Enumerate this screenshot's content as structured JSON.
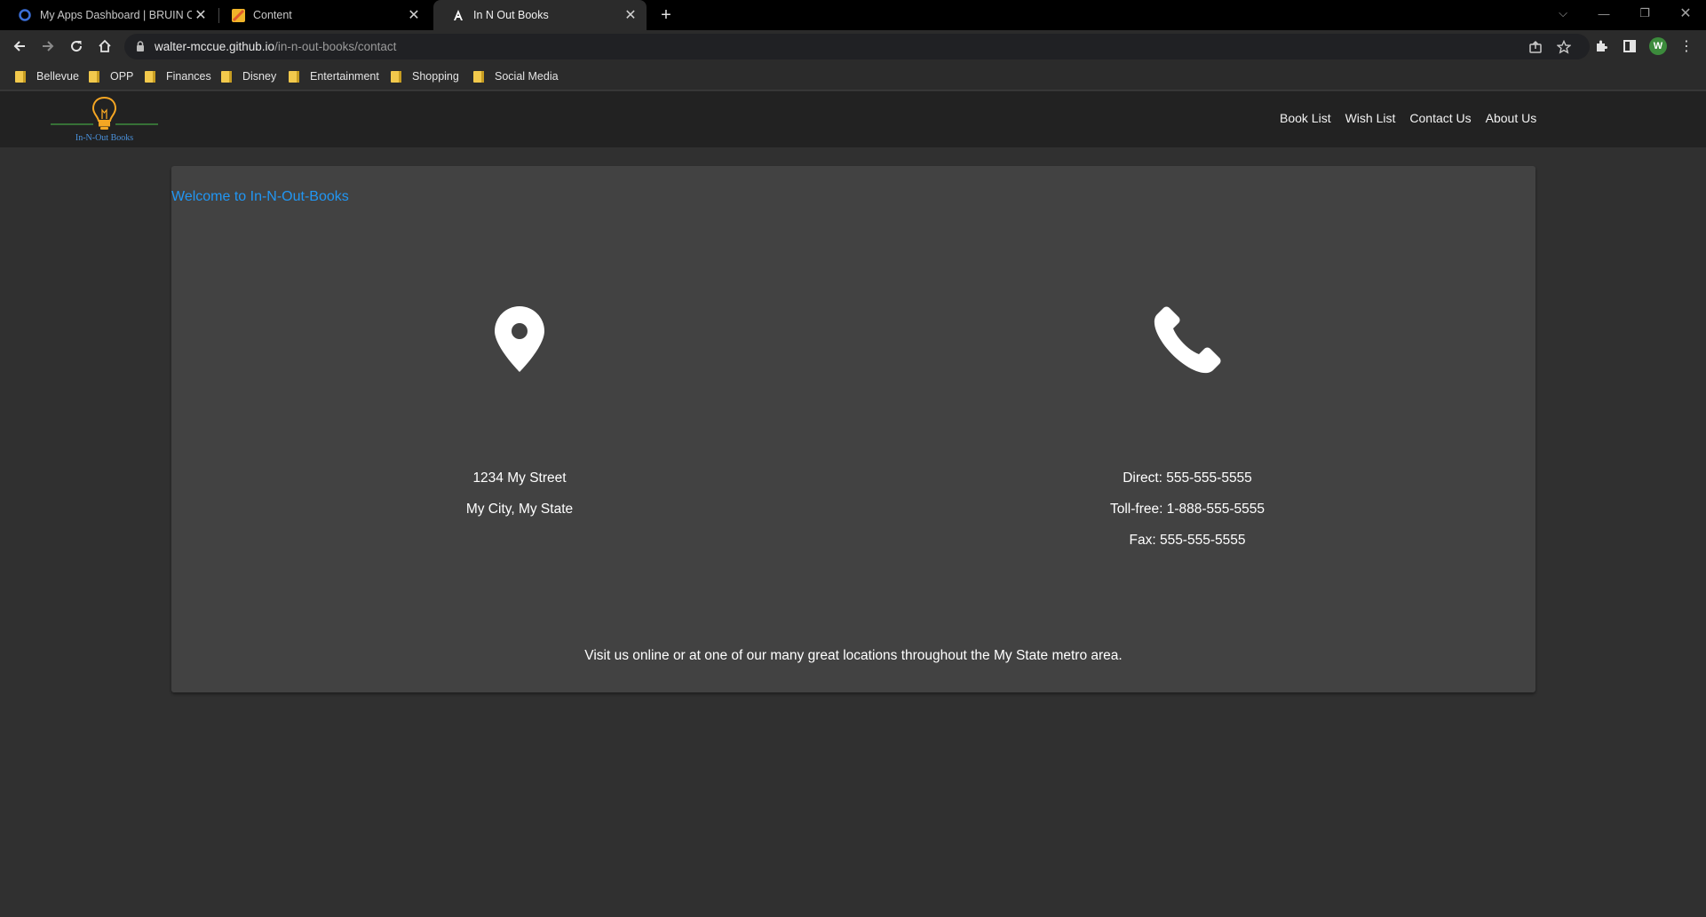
{
  "browser": {
    "tabs": [
      {
        "title": "My Apps Dashboard | BRUIN Co",
        "icon": "okta-icon",
        "active": false
      },
      {
        "title": "Content",
        "icon": "content-icon",
        "active": false
      },
      {
        "title": "In N Out Books",
        "icon": "angular-icon",
        "active": true
      }
    ],
    "new_tab_label": "+",
    "url": {
      "host": "walter-mccue.github.io",
      "path": "/in-n-out-books/contact"
    },
    "profile_initial": "W",
    "bookmarks": [
      "Bellevue",
      "OPP",
      "Finances",
      "Disney",
      "Entertainment",
      "Shopping",
      "Social Media"
    ]
  },
  "site": {
    "logo_text": "In-N-Out Books",
    "nav": [
      "Book List",
      "Wish List",
      "Contact Us",
      "About Us"
    ],
    "welcome": "Welcome to In-N-Out-Books",
    "address": [
      "1234 My Street",
      "My City, My State"
    ],
    "phones": [
      "Direct: 555-555-5555",
      "Toll-free: 1-888-555-5555",
      "Fax: 555-555-5555"
    ],
    "visit_text": "Visit us online or at one of our many great locations throughout the My State metro area."
  },
  "colors": {
    "accent": "#2196f3",
    "logo_bulb": "#f5a623",
    "logo_line": "#3d8b3d",
    "card": "#424242",
    "header": "#222222",
    "background": "#303030"
  }
}
